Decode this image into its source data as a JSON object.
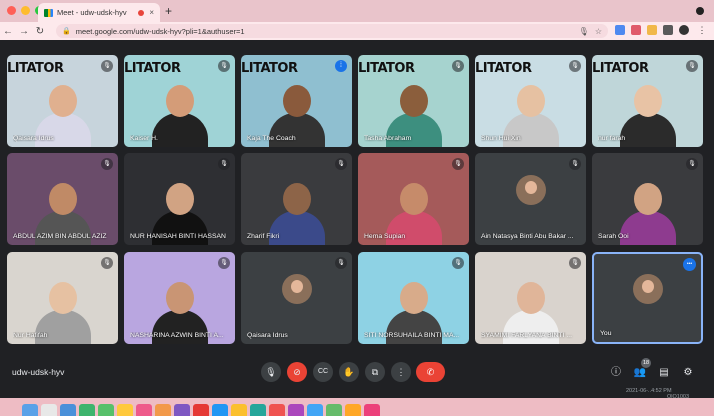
{
  "browser": {
    "tab_title": "Meet - udw-udsk-hyv",
    "new_tab": "+",
    "close": "×",
    "url": "meet.google.com/udw-udsk-hyv?pli=1&authuser=1",
    "back": "←",
    "forward": "→",
    "reload": "↻"
  },
  "banner_text": "LITATOR",
  "participants": [
    {
      "name": "Qaisara Idrus",
      "mic": "muted",
      "banner": true
    },
    {
      "name": "Kaiser H.",
      "mic": "muted",
      "banner": true
    },
    {
      "name": "Kaja The Coach",
      "mic": "speaking",
      "banner": true
    },
    {
      "name": "Tasha Abraham",
      "mic": "muted",
      "banner": true
    },
    {
      "name": "Shun Hui Xin",
      "mic": "muted",
      "banner": true
    },
    {
      "name": "nur farah",
      "mic": "muted",
      "banner": true
    },
    {
      "name": "ABDUL AZIM BIN ABDUL AZIZ",
      "mic": "muted"
    },
    {
      "name": "NUR HANISAH BINTI HASSAN",
      "mic": "muted"
    },
    {
      "name": "Zharif Fikri",
      "mic": "muted"
    },
    {
      "name": "Hema Supian",
      "mic": "muted"
    },
    {
      "name": "Ain Natasya Binti Abu Bakar ...",
      "mic": "muted",
      "avatar": true
    },
    {
      "name": "Sarah Ooi",
      "mic": "muted"
    },
    {
      "name": "Nur Hafifah",
      "mic": "muted"
    },
    {
      "name": "NASHARINA AZWIN BINTI A...",
      "mic": "muted"
    },
    {
      "name": "Qaisara Idrus",
      "mic": "muted",
      "avatar": true
    },
    {
      "name": "SITI NORSUHAILA BINTI MA...",
      "mic": "muted"
    },
    {
      "name": "SYAMIMI FARLYANA BINTI ...",
      "mic": "muted"
    },
    {
      "name": "You",
      "mic": "more",
      "avatar": true,
      "self": true
    }
  ],
  "meeting": {
    "code": "udw-udsk-hyv",
    "people_count": "18",
    "time": "2021-06-..4:52 PM",
    "zoom_id": "OlO1003"
  },
  "controls": {
    "mic_icon": "🎙",
    "camera_off_icon": "⊘",
    "captions_icon": "CC",
    "hand_icon": "✋",
    "present_icon": "⧉",
    "more_icon": "⋮",
    "hangup_icon": "✆",
    "info_icon": "ⓘ",
    "people_icon": "👥",
    "chat_icon": "▤",
    "activities_icon": "⚙"
  },
  "colors": {
    "meet_bg": "#202124",
    "tile_bg": "#3c4043",
    "accent_blue": "#1a73e8",
    "hangup_red": "#ea4335"
  }
}
